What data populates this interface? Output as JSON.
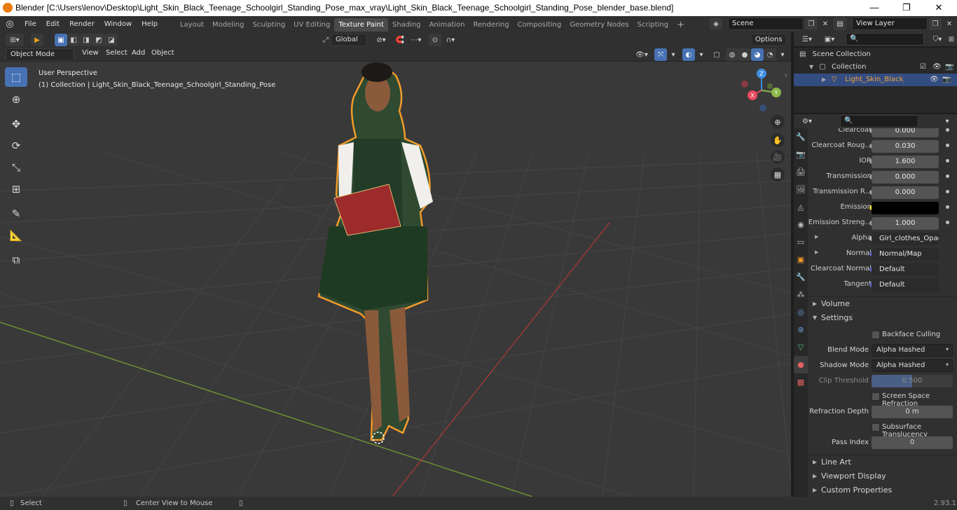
{
  "window": {
    "title": "Blender [C:\\Users\\lenov\\Desktop\\Light_Skin_Black_Teenage_Schoolgirl_Standing_Pose_max_vray\\Light_Skin_Black_Teenage_Schoolgirl_Standing_Pose_blender_base.blend]",
    "minimize": "—",
    "maximize": "❐",
    "close": "✕"
  },
  "menu": [
    "File",
    "Edit",
    "Render",
    "Window",
    "Help"
  ],
  "workspaces": [
    "Layout",
    "Modeling",
    "Sculpting",
    "UV Editing",
    "Texture Paint",
    "Shading",
    "Animation",
    "Rendering",
    "Compositing",
    "Geometry Nodes",
    "Scripting"
  ],
  "active_workspace": "Texture Paint",
  "scene": {
    "name": "Scene",
    "view_layer": "View Layer"
  },
  "header": {
    "transform_orientation": "Global",
    "options_label": "Options",
    "mode": "Object Mode",
    "menus": [
      "View",
      "Select",
      "Add",
      "Object"
    ]
  },
  "viewport": {
    "title": "User Perspective",
    "subtitle": "(1) Collection | Light_Skin_Black_Teenage_Schoolgirl_Standing_Pose",
    "gizmo_axes": [
      "Z",
      "X",
      "Y"
    ]
  },
  "outliner": {
    "root": "Scene Collection",
    "collection": "Collection",
    "object": "Light_Skin_Black_Teenag"
  },
  "properties": {
    "rows": [
      {
        "label": "Clearcoat",
        "value": "0.000"
      },
      {
        "label": "Clearcoat Roug...",
        "value": "0.030"
      },
      {
        "label": "IOR",
        "value": "1.600"
      },
      {
        "label": "Transmission",
        "value": "0.000"
      },
      {
        "label": "Transmission R...",
        "value": "0.000"
      },
      {
        "label": "Emission",
        "value": ""
      },
      {
        "label": "Emission Streng...",
        "value": "1.000"
      },
      {
        "label": "Alpha",
        "value": "Girl_clothes_Opacity..."
      },
      {
        "label": "Normal",
        "value": "Normal/Map"
      },
      {
        "label": "Clearcoat Normal",
        "value": "Default"
      },
      {
        "label": "Tangent",
        "value": "Default"
      }
    ],
    "sections": {
      "volume": "Volume",
      "settings": "Settings",
      "line_art": "Line Art",
      "viewport_display": "Viewport Display",
      "custom_properties": "Custom Properties"
    },
    "settings": {
      "backface_culling": "Backface Culling",
      "blend_mode_label": "Blend Mode",
      "blend_mode": "Alpha Hashed",
      "shadow_mode_label": "Shadow Mode",
      "shadow_mode": "Alpha Hashed",
      "clip_threshold_label": "Clip Threshold",
      "clip_threshold": "0.500",
      "ssr_label": "Screen Space Refraction",
      "refraction_depth_label": "Refraction Depth",
      "refraction_depth": "0 m",
      "subsurface_label": "Subsurface Translucency",
      "pass_index_label": "Pass Index",
      "pass_index": "0"
    }
  },
  "status": {
    "left": "Select",
    "middle": "Center View to Mouse",
    "version": "2.93.1"
  },
  "colors": {
    "accent": "#4772b3",
    "selection_outline": "#f39b2b",
    "x_axis": "#e84a5f",
    "y_axis": "#8cb84a",
    "z_axis": "#3f8ee0"
  }
}
